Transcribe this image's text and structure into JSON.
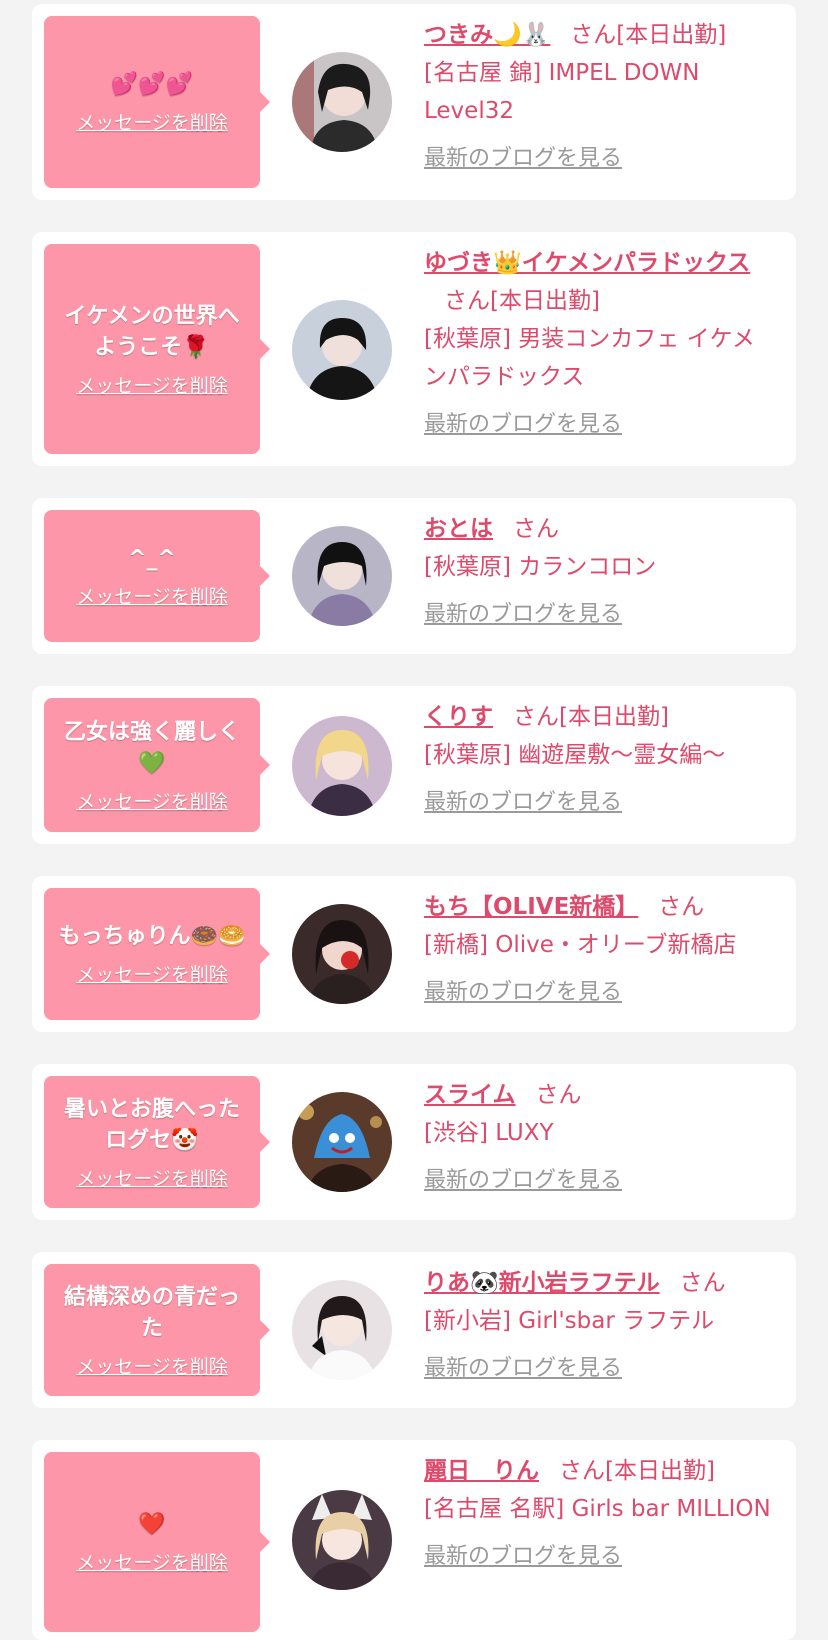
{
  "colors": {
    "accent": "#de4a6b",
    "bubble": "#fd96a8",
    "background": "#f3f3f3"
  },
  "common": {
    "delete_label": "メッセージを削除",
    "blog_label": "最新のブログを見る"
  },
  "entries": [
    {
      "message": "💕💕💕",
      "name": "つきみ🌙🐰",
      "honorific": "さん",
      "status": "[本日出勤]",
      "shop": "[名古屋 錦] IMPEL DOWN Level32"
    },
    {
      "message": "イケメンの世界へようこそ🌹",
      "name": "ゆづき👑イケメンパラドックス",
      "honorific": "さん",
      "status": "[本日出勤]",
      "shop": "[秋葉原] 男装コンカフェ イケメンパラドックス"
    },
    {
      "message": "^_^",
      "name": "おとは",
      "honorific": "さん",
      "status": "",
      "shop": "[秋葉原] カランコロン"
    },
    {
      "message": "乙女は強く麗しく💚",
      "name": "くりす",
      "honorific": "さん",
      "status": "[本日出勤]",
      "shop": "[秋葉原] 幽遊屋敷〜霊女編〜"
    },
    {
      "message": "もっちゅりん🍩🥯",
      "name": "もち【OLIVE新橋】",
      "honorific": "さん",
      "status": "",
      "shop": "[新橋] Olive・オリーブ新橋店"
    },
    {
      "message": "暑いとお腹へったログセ🤡",
      "name": "スライム",
      "honorific": "さん",
      "status": "",
      "shop": "[渋谷] LUXY"
    },
    {
      "message": "結構深めの青だった",
      "name": "りあ🐼新小岩ラフテル",
      "honorific": "さん",
      "status": "",
      "shop": "[新小岩] Girl'sbar ラフテル"
    },
    {
      "message": "❤️",
      "name": "麗日　りん",
      "honorific": "さん",
      "status": "[本日出勤]",
      "shop": "[名古屋 名駅] Girls bar MILLION"
    }
  ]
}
